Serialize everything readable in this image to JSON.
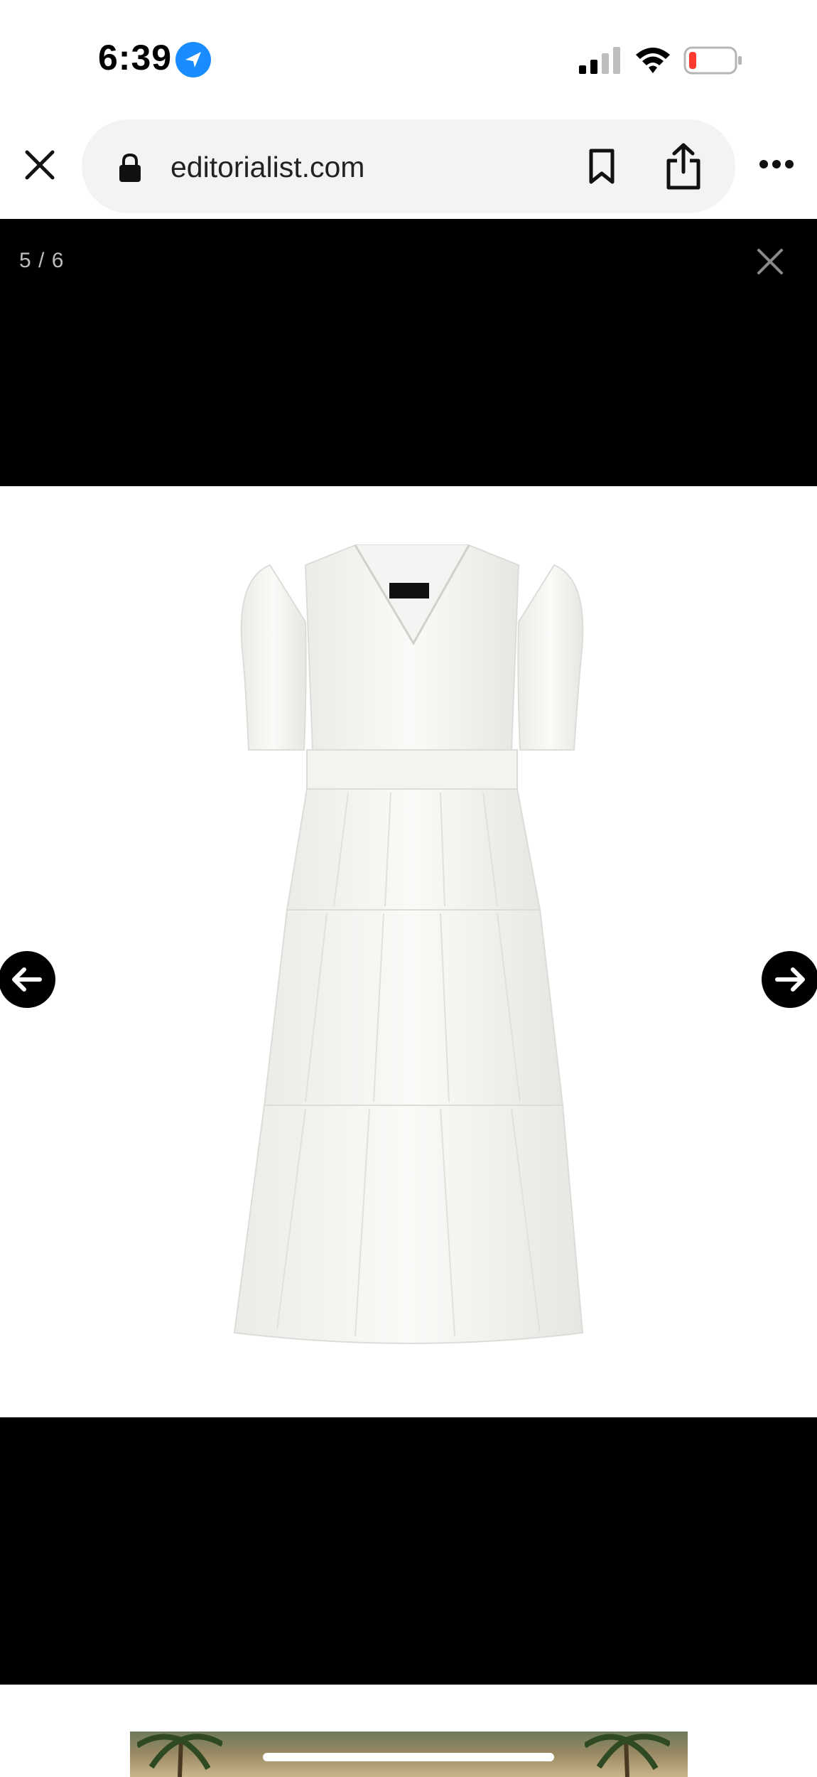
{
  "status_bar": {
    "time": "6:39",
    "battery_color": "#ff3b30"
  },
  "browser": {
    "url": "editorialist.com",
    "icons": [
      "close-icon",
      "lock-icon",
      "bookmark-icon",
      "share-icon",
      "more-icon"
    ]
  },
  "viewer": {
    "counter": "5 / 6",
    "current_index": 5,
    "total": 6,
    "image_subject": "white tiered midi dress",
    "background": "#000000"
  },
  "nav": {
    "prev_icon": "arrow-left-icon",
    "next_icon": "arrow-right-icon"
  }
}
